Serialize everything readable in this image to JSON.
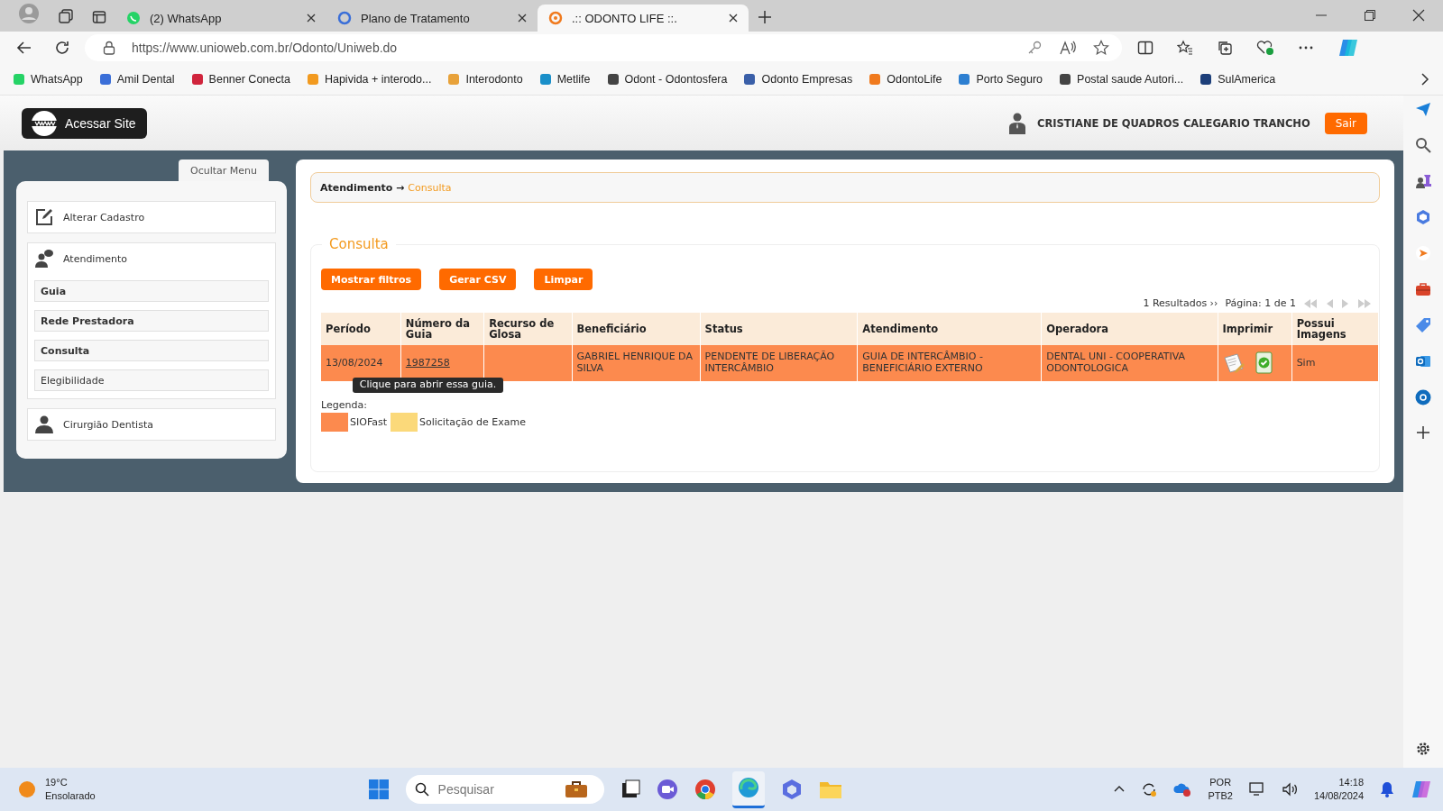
{
  "browser": {
    "tabs": [
      {
        "title": "(2) WhatsApp",
        "selected": false
      },
      {
        "title": "Plano de Tratamento",
        "selected": false
      },
      {
        "title": ".:: ODONTO LIFE ::.",
        "selected": true
      }
    ],
    "url": "https://www.unioweb.com.br/Odonto/Uniweb.do",
    "bookmarks": [
      "WhatsApp",
      "Amil Dental",
      "Benner Conecta",
      "Hapivida + interodo...",
      "Interodonto",
      "Metlife",
      "Odont - Odontosfera",
      "Odonto Empresas",
      "OdontoLife",
      "Porto Seguro",
      "Postal saude Autori...",
      "SulAmerica"
    ]
  },
  "site": {
    "access_button": "Acessar Site",
    "user_name": "CRISTIANE DE QUADROS CALEGARIO TRANCHO",
    "logout": "Sair",
    "hide_menu": "Ocultar Menu",
    "menu": [
      {
        "label": "Alterar Cadastro"
      },
      {
        "label": "Atendimento",
        "children": [
          {
            "label": "Guia",
            "emphasized": true
          },
          {
            "label": "Rede Prestadora",
            "emphasized": true
          },
          {
            "label": "Consulta",
            "emphasized": true
          },
          {
            "label": "Elegibilidade",
            "emphasized": false
          }
        ]
      },
      {
        "label": "Cirurgião Dentista"
      }
    ],
    "breadcrumb": {
      "parent": "Atendimento →",
      "current": "Consulta"
    },
    "panel_title": "Consulta",
    "buttons": [
      "Mostrar filtros",
      "Gerar CSV",
      "Limpar"
    ],
    "results": "1 Resultados ››",
    "page": "Página: 1 de 1",
    "table": {
      "columns": [
        "Período",
        "Número da Guia",
        "Recurso de Glosa",
        "Beneficiário",
        "Status",
        "Atendimento",
        "Operadora",
        "Imprimir",
        "Possui Imagens"
      ],
      "rows": [
        {
          "color": "#fc8a4e",
          "periodo": "13/08/2024",
          "numero": "1987258",
          "beneficiario": "GABRIEL HENRIQUE DA SILVA",
          "status": "PENDENTE DE LIBERAÇÃO INTERCÂMBIO",
          "atendimento": "GUIA DE INTERCÂMBIO - BENEFICIÁRIO EXTERNO",
          "operadora": "DENTAL UNI - COOPERATIVA ODONTOLOGICA",
          "imagens": "Sim"
        }
      ]
    },
    "tooltip": "Clique para abrir essa guia.",
    "legend": {
      "title": "Legenda:",
      "items": [
        {
          "label": "SIOFast",
          "color": "#fc8a4e"
        },
        {
          "label": "Solicitação de Exame",
          "color": "#fbd97a"
        }
      ]
    }
  },
  "taskbar": {
    "temperature": "19°C",
    "weather": "Ensolarado",
    "search_placeholder": "Pesquisar",
    "language": "POR",
    "layout": "PTB2",
    "time": "14:18",
    "date": "14/08/2024"
  }
}
